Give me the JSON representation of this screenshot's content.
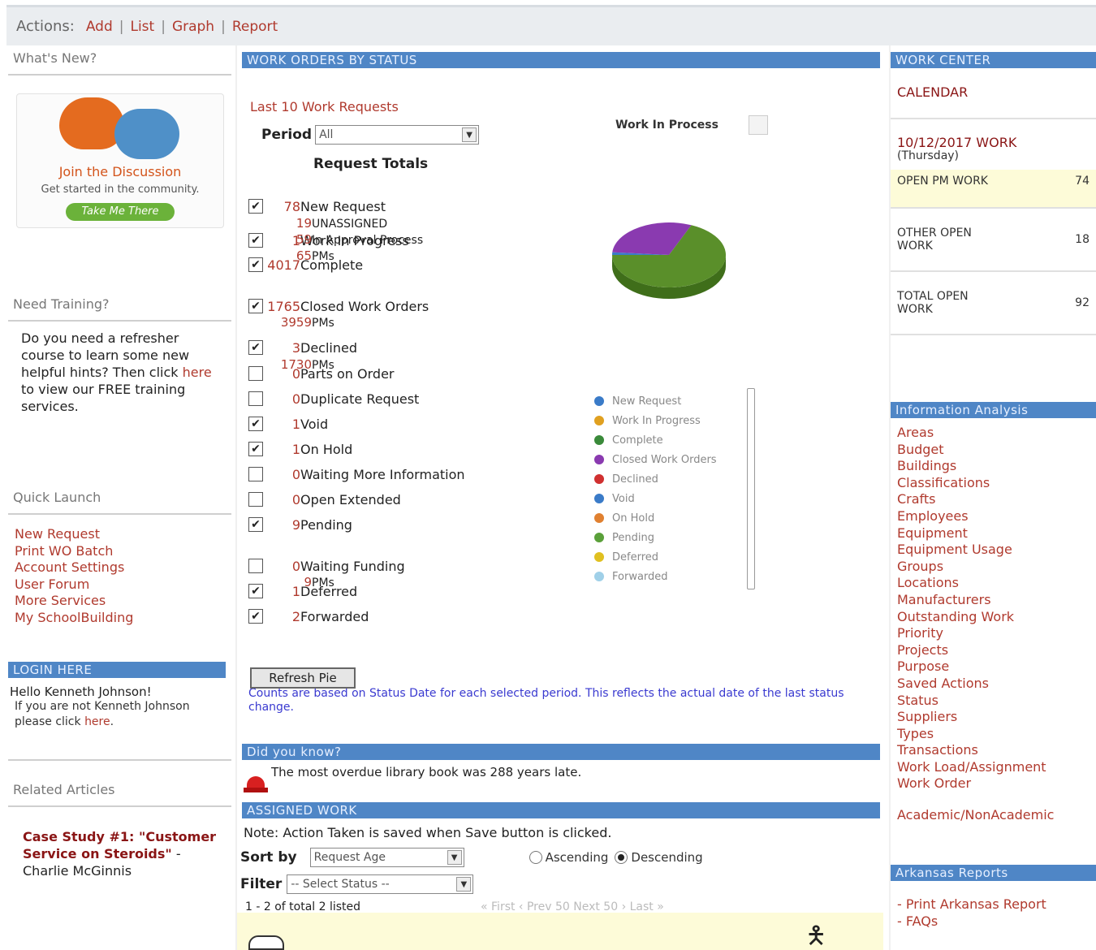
{
  "actions": {
    "label": "Actions:",
    "items": [
      "Add",
      "List",
      "Graph",
      "Report"
    ]
  },
  "left": {
    "whats_new": "What's New?",
    "promo": {
      "title": "Join the Discussion",
      "subtitle": "Get started in the community.",
      "button": "Take Me There"
    },
    "need_training": "Need Training?",
    "training_text_1": "Do you need a refresher course to learn some new helpful hints? Then click ",
    "training_link": "here",
    "training_text_2": " to view our FREE training services.",
    "quick_launch": "Quick Launch",
    "quick_links": [
      "New Request",
      "Print WO Batch",
      "Account Settings",
      "User Forum",
      "More Services",
      "My SchoolBuilding"
    ],
    "login_bar": "LOGIN HERE",
    "hello": "Hello Kenneth Johnson!",
    "not_you_1": "If you are not Kenneth Johnson please click ",
    "not_you_link": "here",
    "not_you_2": ".",
    "related": "Related Articles",
    "article_1": "Case Study #1: \"Customer Service on Steroids\"",
    "article_2": " - Charlie McGinnis"
  },
  "middle": {
    "wo_bar": "WORK ORDERS BY STATUS",
    "last10": "Last 10 Work Requests",
    "period_label": "Period",
    "period_value": "All",
    "chart_title": "Work In Process",
    "totals_heading": "Request Totals",
    "rows": [
      {
        "checked": true,
        "count": "78",
        "label": "New Request"
      },
      {
        "checked": true,
        "count": "1",
        "label": "Work In Progress"
      },
      {
        "checked": true,
        "count": "4017",
        "label": "Complete"
      },
      {
        "checked": true,
        "count": "1765",
        "label": "Closed Work Orders"
      },
      {
        "checked": true,
        "count": "3",
        "label": "Declined"
      },
      {
        "checked": false,
        "count": "0",
        "label": "Parts on Order"
      },
      {
        "checked": false,
        "count": "0",
        "label": "Duplicate Request"
      },
      {
        "checked": true,
        "count": "1",
        "label": "Void"
      },
      {
        "checked": true,
        "count": "1",
        "label": "On Hold"
      },
      {
        "checked": false,
        "count": "0",
        "label": "Waiting More Information"
      },
      {
        "checked": false,
        "count": "0",
        "label": "Open Extended"
      },
      {
        "checked": true,
        "count": "9",
        "label": "Pending"
      },
      {
        "checked": false,
        "count": "0",
        "label": "Waiting Funding"
      },
      {
        "checked": true,
        "count": "1",
        "label": "Deferred"
      },
      {
        "checked": true,
        "count": "2",
        "label": "Forwarded"
      }
    ],
    "sub_rows": [
      {
        "count": "19",
        "label": "UNASSIGNED"
      },
      {
        "count": "59",
        "label": "In Approval Process"
      },
      {
        "count": "65",
        "label": "PMs"
      },
      {
        "count": "3959",
        "label": "PMs"
      },
      {
        "count": "1730",
        "label": "PMs"
      },
      {
        "count": "9",
        "label": "PMs"
      }
    ],
    "legend": [
      {
        "label": "New Request",
        "color": "#3a7bc8"
      },
      {
        "label": "Work In Progress",
        "color": "#e0a020"
      },
      {
        "label": "Complete",
        "color": "#3a8a3a"
      },
      {
        "label": "Closed Work Orders",
        "color": "#8a3ab0"
      },
      {
        "label": "Declined",
        "color": "#d03030"
      },
      {
        "label": "Void",
        "color": "#3a7bc8"
      },
      {
        "label": "On Hold",
        "color": "#e08030"
      },
      {
        "label": "Pending",
        "color": "#5aa03a"
      },
      {
        "label": "Deferred",
        "color": "#e0c020"
      },
      {
        "label": "Forwarded",
        "color": "#a0d0e8"
      }
    ],
    "refresh_button": "Refresh Pie",
    "note": "Counts are based on Status Date for each selected period. This reflects the actual date of the last status change.",
    "did_you_know_bar": "Did you know?",
    "fact": "The most overdue library book was 288 years late.",
    "assigned_bar": "ASSIGNED WORK",
    "assigned_note": "Note: Action Taken is saved when Save button is clicked.",
    "sort_label": "Sort by",
    "sort_value": "Request Age",
    "ascending": "Ascending",
    "descending": "Descending",
    "filter_label": "Filter",
    "filter_value": "-- Select Status --",
    "listed": "1 - 2 of total 2 listed",
    "pager": "« First ‹ Prev 50 Next 50 › Last »"
  },
  "right": {
    "wc_bar": "WORK CENTER",
    "calendar": "CALENDAR",
    "date_work": "10/12/2017 WORK",
    "weekday": "(Thursday)",
    "open_pm": "OPEN PM WORK",
    "open_pm_count": "74",
    "other_open": "OTHER OPEN WORK",
    "other_open_count": "18",
    "total_open": "TOTAL OPEN WORK",
    "total_open_count": "92",
    "ia_bar": "Information Analysis",
    "ia_items": [
      "Areas",
      "Budget",
      "Buildings",
      "Classifications",
      "Crafts",
      "Employees",
      "Equipment",
      "Equipment Usage",
      "Groups",
      "Locations",
      "Manufacturers",
      "Outstanding Work",
      "Priority",
      "Projects",
      "Purpose",
      "Saved Actions",
      "Status",
      "Suppliers",
      "Types",
      "Transactions",
      "Work Load/Assignment",
      "Work Order"
    ],
    "academic": "Academic/NonAcademic",
    "ark_bar": "Arkansas Reports",
    "ark_items": [
      "- Print Arkansas Report",
      "- FAQs"
    ]
  },
  "chart_data": {
    "type": "pie",
    "title": "Work In Process",
    "categories": [
      "New Request",
      "Closed Work Orders",
      "Complete"
    ],
    "values": [
      78,
      1765,
      4017
    ]
  }
}
